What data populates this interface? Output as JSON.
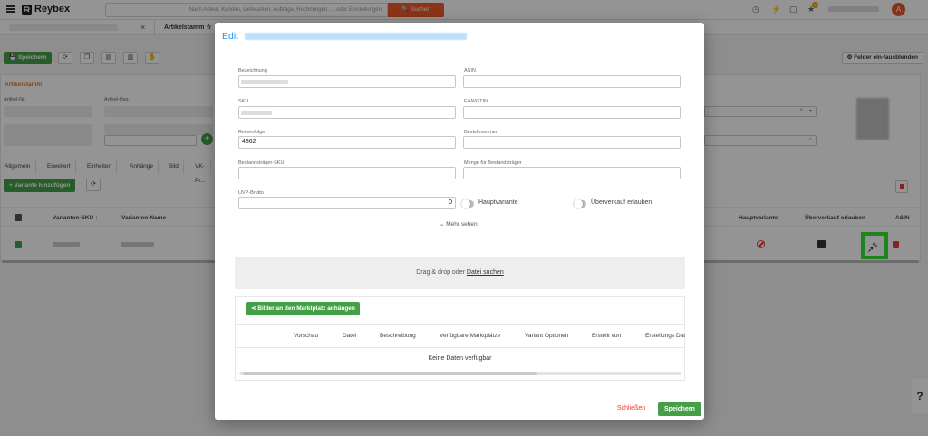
{
  "app": {
    "brand": "Reybex",
    "search_placeholder": "Nach Artikel, Kunden, Lieferanten, Aufträge, Rechnungen, ... oder Einstellungen",
    "search_button": "Suchen",
    "notification_badge": "2",
    "avatar_initial": "A"
  },
  "tabs": {
    "close_glyph": "×",
    "active": "Artikelstamm"
  },
  "toolbar": {
    "save": "Speichern",
    "fields_toggle": "Felder ein-/ausblenden"
  },
  "article_card": {
    "title": "Artikelstamm",
    "label_number": "Artikel-Nr.",
    "label_desc": "Artikel-Bez."
  },
  "sub_tabs": [
    "Allgemein",
    "Erweitert",
    "Einheiten",
    "Anhänge",
    "Bild",
    "VK-Pr..."
  ],
  "variants": {
    "add_button": "Variante hinzufügen",
    "columns": {
      "sku": "Varianten-SKU",
      "name": "Varianten-Name",
      "main_variant": "Hauptvariante",
      "oversell": "Überverkauf erlauben",
      "asin": "ASIN"
    }
  },
  "modal": {
    "title": "Edit",
    "fields": {
      "bezeichnung": {
        "label": "Bezeichnung",
        "value": ""
      },
      "asin": {
        "label": "ASIN",
        "value": ""
      },
      "sku": {
        "label": "SKU",
        "value": ""
      },
      "ean": {
        "label": "EAN/GTIN",
        "value": ""
      },
      "reihenfolge": {
        "label": "Reihenfolge",
        "value": "4862"
      },
      "bestellnummer": {
        "label": "Bestellnummer",
        "value": ""
      },
      "bestandstraeger_sku": {
        "label": "Bestandsträger-SKU",
        "value": ""
      },
      "menge": {
        "label": "Menge für Bestandsträger",
        "value": ""
      },
      "uvp": {
        "label": "UVP-Brutto",
        "value": "0"
      }
    },
    "toggles": {
      "hauptvariante": "Hauptvariante",
      "ueberverkauf": "Überverkauf erlauben"
    },
    "more": "Mehr sehen",
    "dropzone": {
      "text": "Drag & drop oder",
      "link": "Datei suchen"
    },
    "media": {
      "attach_button": "Bilder an den Marktplatz anhängen",
      "columns": [
        "Vorschau",
        "Datei",
        "Beschreibung",
        "Verfügbare Marktplätze",
        "Variant Optionen",
        "Erstellt von",
        "Erstellungs Dat"
      ],
      "empty": "Keine Daten verfügbar"
    },
    "close": "Schließen",
    "save": "Speichern"
  }
}
